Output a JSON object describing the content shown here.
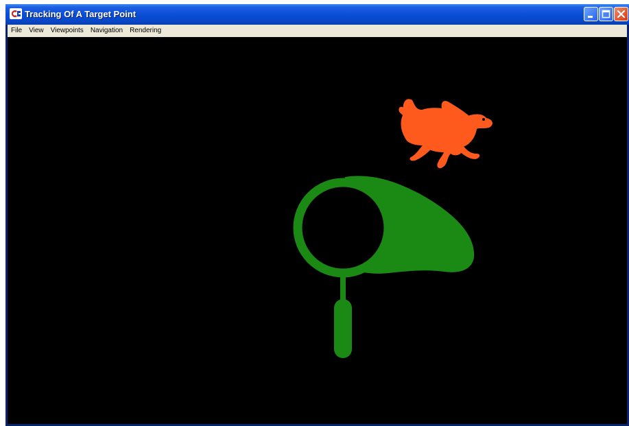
{
  "window": {
    "title": "Tracking Of A Target Point"
  },
  "menu": {
    "items": [
      "File",
      "View",
      "Viewpoints",
      "Navigation",
      "Rendering"
    ]
  },
  "scene": {
    "background_color": "#000000",
    "target_icon": "rabbit-icon",
    "target_color": "#ff5a1e",
    "tracker_icon": "butterfly-net-icon",
    "tracker_color": "#1b8a14"
  },
  "colors": {
    "titlebar": "#0a4fd8",
    "menubar": "#ece9d8",
    "close_button": "#d83a14"
  }
}
